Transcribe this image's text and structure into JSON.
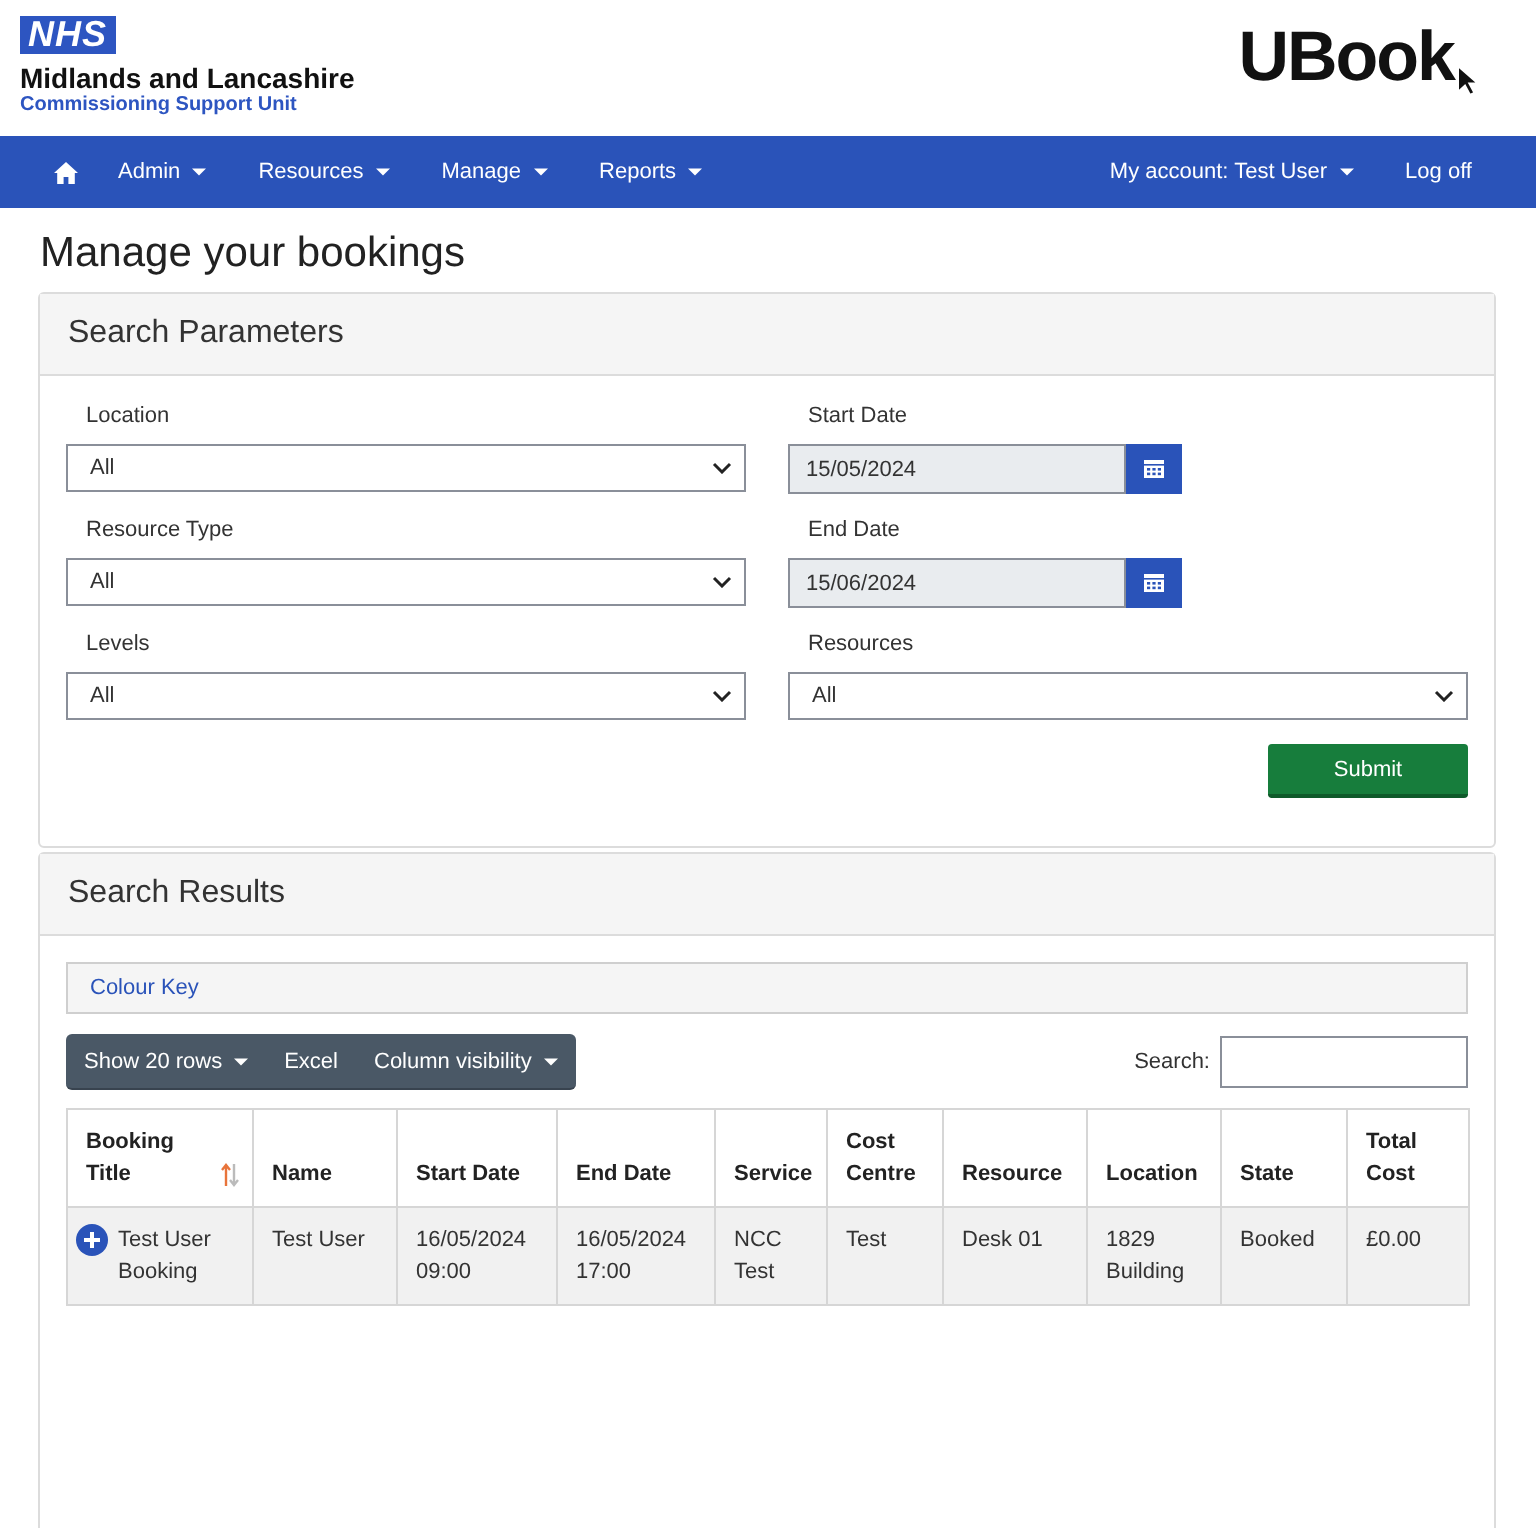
{
  "header": {
    "nhs_badge": "NHS",
    "organisation": "Midlands and Lancashire",
    "unit": "Commissioning Support Unit",
    "app_logo": "UBook"
  },
  "nav": {
    "menus": [
      {
        "label": "Admin",
        "dropdown": true
      },
      {
        "label": "Resources",
        "dropdown": true
      },
      {
        "label": "Manage",
        "dropdown": true
      },
      {
        "label": "Reports",
        "dropdown": true
      }
    ],
    "account_menu": [
      {
        "label": "My account: Test User",
        "dropdown": true
      },
      {
        "label": "Log off",
        "dropdown": false
      }
    ]
  },
  "page_title": "Manage your bookings",
  "search_parameters": {
    "title": "Search Parameters",
    "fields": [
      {
        "label": "Location",
        "kind": "select",
        "value": "All"
      },
      {
        "label": "Start Date",
        "kind": "date",
        "value": "15/05/2024"
      },
      {
        "label": "Resource Type",
        "kind": "select",
        "value": "All"
      },
      {
        "label": "End Date",
        "kind": "date",
        "value": "15/06/2024"
      },
      {
        "label": "Levels",
        "kind": "select",
        "value": "All"
      },
      {
        "label": "Resources",
        "kind": "select",
        "value": "All"
      }
    ],
    "submit": "Submit"
  },
  "search_results": {
    "title": "Search Results",
    "colour_key": "Colour Key",
    "toolbar": [
      {
        "label": "Show 20 rows",
        "dropdown": true
      },
      {
        "label": "Excel",
        "dropdown": false
      },
      {
        "label": "Column visibility",
        "dropdown": true
      }
    ],
    "search_label": "Search:",
    "table": {
      "columns": [
        {
          "label": "Booking Title",
          "sorted": true
        },
        {
          "label": "Name",
          "sorted": false
        },
        {
          "label": "Start Date",
          "sorted": false
        },
        {
          "label": "End Date",
          "sorted": false
        },
        {
          "label": "Service",
          "sorted": false
        },
        {
          "label": "Cost Centre",
          "sorted": false
        },
        {
          "label": "Resource",
          "sorted": false
        },
        {
          "label": "Location",
          "sorted": false
        },
        {
          "label": "State",
          "sorted": false
        },
        {
          "label": "Total Cost",
          "sorted": false
        }
      ],
      "rows": [
        {
          "expanded": false,
          "cells": [
            "Test User Booking",
            "Test User",
            "16/05/2024 09:00",
            "16/05/2024 17:00",
            "NCC Test",
            "Test",
            "Desk 01",
            "1829 Building",
            "Booked",
            "£0.00"
          ]
        }
      ]
    }
  }
}
